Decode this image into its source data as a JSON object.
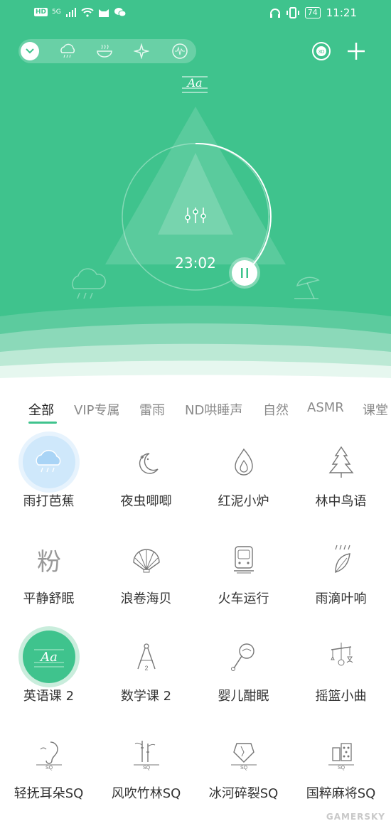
{
  "status": {
    "time": "11:21",
    "battery": "74",
    "hd": "HD",
    "net": "5G"
  },
  "hero": {
    "timer": "23:02"
  },
  "tabs": [
    "全部",
    "VIP专属",
    "雷雨",
    "ND哄睡声",
    "自然",
    "ASMR",
    "课堂"
  ],
  "sounds": [
    {
      "label": "雨打芭蕉",
      "icon": "rain-cloud-icon",
      "active": true
    },
    {
      "label": "夜虫唧唧",
      "icon": "moon-stars-icon"
    },
    {
      "label": "红泥小炉",
      "icon": "flame-icon"
    },
    {
      "label": "林中鸟语",
      "icon": "pine-tree-icon"
    },
    {
      "label": "平静舒眠",
      "icon": "fen-character-icon",
      "glyph": "粉"
    },
    {
      "label": "浪卷海贝",
      "icon": "seashell-icon"
    },
    {
      "label": "火车运行",
      "icon": "train-icon"
    },
    {
      "label": "雨滴叶响",
      "icon": "rain-leaf-icon"
    },
    {
      "label": "英语课 2",
      "icon": "english-class-icon",
      "active": true
    },
    {
      "label": "数学课 2",
      "icon": "compass-icon"
    },
    {
      "label": "婴儿酣眠",
      "icon": "baby-rattle-icon"
    },
    {
      "label": "摇篮小曲",
      "icon": "crib-mobile-icon"
    },
    {
      "label": "轻抚耳朵SQ",
      "icon": "ear-sq-icon",
      "badge": "SQ"
    },
    {
      "label": "风吹竹林SQ",
      "icon": "bamboo-sq-icon",
      "badge": "SQ"
    },
    {
      "label": "冰河碎裂SQ",
      "icon": "ice-sq-icon",
      "badge": "SQ"
    },
    {
      "label": "国粹麻将SQ",
      "icon": "mahjong-sq-icon",
      "badge": "SQ"
    }
  ],
  "watermark": "GAMERSKY",
  "colors": {
    "accent": "#3fc38d",
    "active_bg": "#cfe8fb"
  }
}
